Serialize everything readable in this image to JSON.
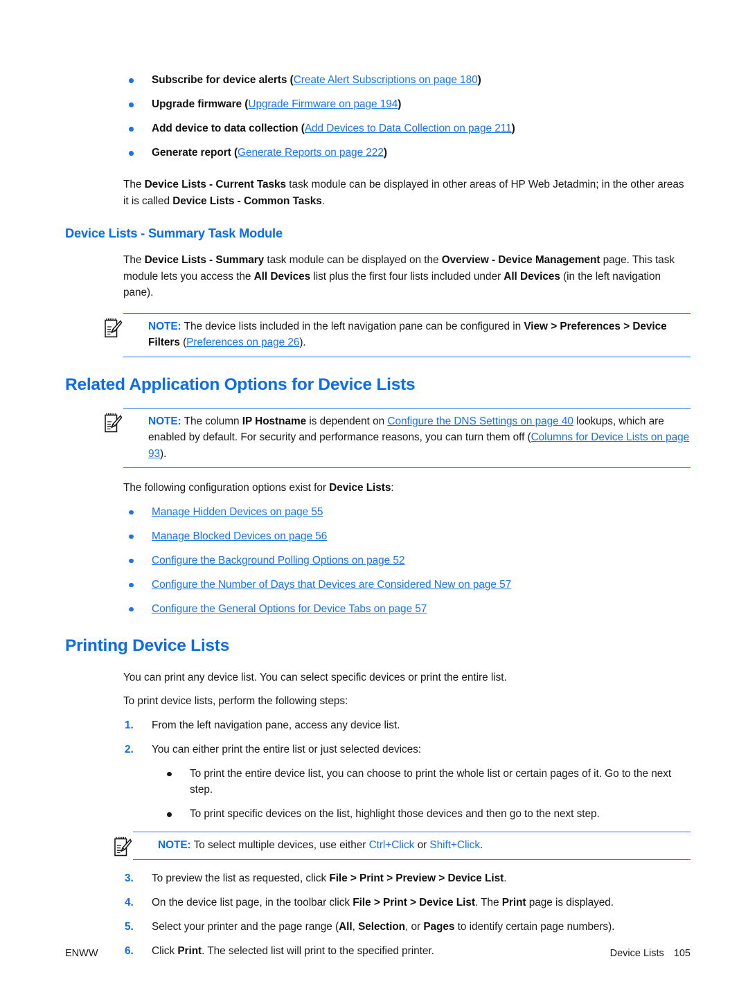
{
  "top_bullets": [
    {
      "bold": "Subscribe for device alerts",
      "paren_open": " (",
      "link": "Create Alert Subscriptions on page 180",
      "paren_close": ")"
    },
    {
      "bold": "Upgrade firmware",
      "paren_open": " (",
      "link": "Upgrade Firmware on page 194",
      "paren_close": ")"
    },
    {
      "bold": "Add device to data collection",
      "paren_open": " (",
      "link": "Add Devices to Data Collection on page 211",
      "paren_close": ")"
    },
    {
      "bold": "Generate report",
      "paren_open": " (",
      "link": "Generate Reports on page 222",
      "paren_close": ")"
    }
  ],
  "para_current_tasks": {
    "t1": "The ",
    "b1": "Device Lists - Current Tasks",
    "t2": " task module can be displayed in other areas of HP Web Jetadmin; in the other areas it is called ",
    "b2": "Device Lists - Common Tasks",
    "t3": "."
  },
  "summary_heading": "Device Lists - Summary Task Module",
  "para_summary": {
    "t1": "The ",
    "b1": "Device Lists - Summary",
    "t2": " task module can be displayed on the ",
    "b2": "Overview - Device Management",
    "t3": " page. This task module lets you access the ",
    "b3": "All Devices",
    "t4": " list plus the first four lists included under ",
    "b4": "All Devices",
    "t5": " (in the left navigation pane)."
  },
  "note1": {
    "label": "NOTE:",
    "t1": "   The device lists included in the left navigation pane can be configured in ",
    "b1": "View > Preferences > Device Filters",
    "t2": " (",
    "link": "Preferences on page 26",
    "t3": ")."
  },
  "related_heading": "Related Application Options for Device Lists",
  "note2": {
    "label": "NOTE:",
    "t1": "   The column ",
    "b1": "IP Hostname",
    "t2": " is dependent on ",
    "link1": "Configure the DNS Settings on page 40",
    "t3": " lookups, which are enabled by default. For security and performance reasons, you can turn them off (",
    "link2": "Columns for Device Lists on page 93",
    "t4": ")."
  },
  "para_config_options": {
    "t1": "The following configuration options exist for ",
    "b1": "Device Lists",
    "t2": ":"
  },
  "option_links": [
    "Manage Hidden Devices on page 55",
    "Manage Blocked Devices on page 56",
    "Configure the Background Polling Options on page 52",
    "Configure the Number of Days that Devices are Considered New on page 57",
    "Configure the General Options for Device Tabs on page 57"
  ],
  "printing_heading": "Printing Device Lists",
  "para_print_intro": "You can print any device list. You can select specific devices or print the entire list.",
  "para_print_steps": "To print device lists, perform the following steps:",
  "step1": "From the left navigation pane, access any device list.",
  "step2": "You can either print the entire list or just selected devices:",
  "sub_bullets": [
    "To print the entire device list, you can choose to print the whole list or certain pages of it. Go to the next step.",
    "To print specific devices on the list, highlight those devices and then go to the next step."
  ],
  "note3": {
    "label": "NOTE:",
    "t1": "   To select multiple devices, use either ",
    "k1": "Ctrl+Click",
    "t2": " or ",
    "k2": "Shift+Click",
    "t3": "."
  },
  "step3": {
    "t1": "To preview the list as requested, click ",
    "b1": "File > Print > Preview > Device List",
    "t2": "."
  },
  "step4": {
    "t1": "On the device list page, in the toolbar click ",
    "b1": "File > Print > Device List",
    "t2": ". The ",
    "b2": "Print",
    "t3": " page is displayed."
  },
  "step5": {
    "t1": "Select your printer and the page range (",
    "b1": "All",
    "t2": ", ",
    "b2": "Selection",
    "t3": ", or ",
    "b3": "Pages",
    "t4": " to identify certain page numbers)."
  },
  "step6": {
    "t1": "Click ",
    "b1": "Print",
    "t2": ". The selected list will print to the specified printer."
  },
  "footer": {
    "left": "ENWW",
    "right_label": "Device Lists",
    "page_number": "105"
  },
  "colors": {
    "heading_blue": "#0c6ce9",
    "link_blue": "#1a74e8",
    "bullet_blue": "#1a74e8",
    "rule_blue": "#1a74e8",
    "text": "#1a1a1a"
  },
  "icons": {
    "note": "note-pencil-icon"
  }
}
